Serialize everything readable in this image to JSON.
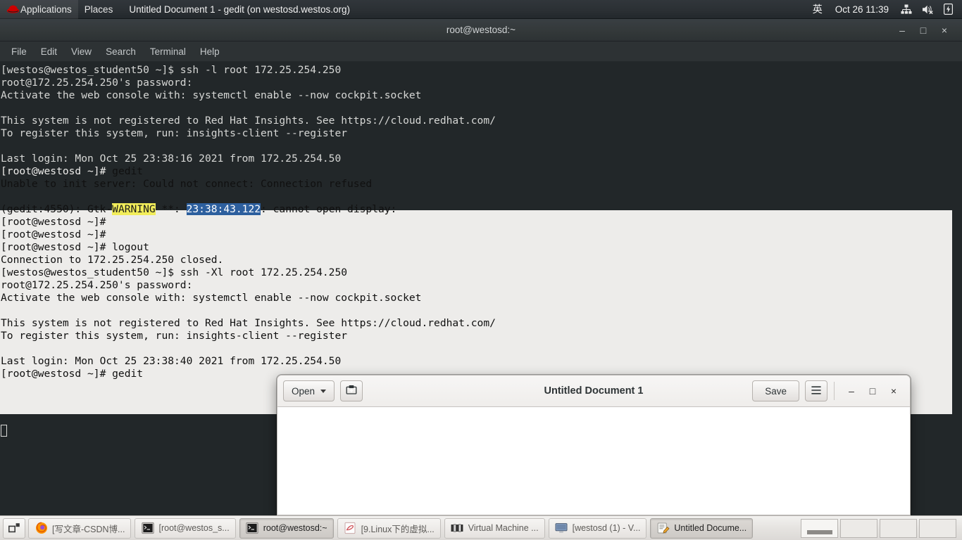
{
  "top_panel": {
    "logo_icon": "redhat-logo-icon",
    "applications_label": "Applications",
    "places_label": "Places",
    "window_title": "Untitled Document 1 - gedit (on westosd.westos.org)",
    "ime_label": "英",
    "clock": "Oct 26  11:39",
    "network_icon": "network-wired-icon",
    "volume_icon": "volume-muted-icon",
    "battery_icon": "battery-charging-icon"
  },
  "terminal": {
    "title": "root@westosd:~",
    "menu": [
      "File",
      "Edit",
      "View",
      "Search",
      "Terminal",
      "Help"
    ],
    "window_buttons": {
      "minimize": "–",
      "maximize": "□",
      "close": "×"
    },
    "lines": [
      {
        "text": "[westos@westos_student50 ~]$ ssh -l root 172.25.254.250",
        "light": false
      },
      {
        "text": "root@172.25.254.250's password:",
        "light": false
      },
      {
        "text": "Activate the web console with: systemctl enable --now cockpit.socket",
        "light": false
      },
      {
        "text": "",
        "light": false
      },
      {
        "text": "This system is not registered to Red Hat Insights. See https://cloud.redhat.com/",
        "light": false
      },
      {
        "text": "To register this system, run: insights-client --register",
        "light": false
      },
      {
        "text": "",
        "light": false
      },
      {
        "text": "Last login: Mon Oct 25 23:38:16 2021 from 172.25.254.50",
        "light": false
      },
      {
        "text": "[root@westosd ~]# gedit",
        "light": true,
        "invert_prefix": "[root@westosd ~]# "
      },
      {
        "text": "Unable to init server: Could not connect: Connection refused",
        "light": true
      },
      {
        "text": "",
        "light": true
      },
      {
        "text": "(gedit:4550): Gtk-WARNING **: 23:38:43.122: cannot open display:",
        "light": true,
        "segments": [
          {
            "t": "(gedit:4550): Gtk-",
            "s": ""
          },
          {
            "t": "WARNING",
            "s": "yellow"
          },
          {
            "t": " **: ",
            "s": ""
          },
          {
            "t": "23:38:43.122",
            "s": "blue"
          },
          {
            "t": ": cannot open display:",
            "s": ""
          }
        ]
      },
      {
        "text": "[root@westosd ~]#",
        "light": true
      },
      {
        "text": "[root@westosd ~]#",
        "light": true
      },
      {
        "text": "[root@westosd ~]# logout",
        "light": true
      },
      {
        "text": "Connection to 172.25.254.250 closed.",
        "light": true
      },
      {
        "text": "[westos@westos_student50 ~]$ ssh -Xl root 172.25.254.250",
        "light": true
      },
      {
        "text": "root@172.25.254.250's password:",
        "light": true
      },
      {
        "text": "Activate the web console with: systemctl enable --now cockpit.socket",
        "light": true
      },
      {
        "text": "",
        "light": true
      },
      {
        "text": "This system is not registered to Red Hat Insights. See https://cloud.redhat.com/",
        "light": true
      },
      {
        "text": "To register this system, run: insights-client --register",
        "light": true
      },
      {
        "text": "",
        "light": true
      },
      {
        "text": "Last login: Mon Oct 25 23:38:40 2021 from 172.25.254.50",
        "light": true
      },
      {
        "text": "[root@westosd ~]# gedit",
        "light": true,
        "invert_tail": true
      }
    ]
  },
  "gedit": {
    "open_label": "Open",
    "new_document_icon": "new-document-icon",
    "title": "Untitled Document 1",
    "save_label": "Save",
    "hamburger_icon": "hamburger-menu-icon",
    "minimize_label": "–",
    "maximize_label": "□",
    "close_label": "×",
    "document_text": ""
  },
  "taskbar": {
    "show_desktop_icon": "show-desktop-icon",
    "tasks": [
      {
        "label": "[写文章-CSDN博...",
        "icon": "firefox-icon",
        "active": false
      },
      {
        "label": "[root@westos_s...",
        "icon": "terminal-icon",
        "active": false
      },
      {
        "label": "root@westosd:~",
        "icon": "terminal-icon",
        "active": true
      },
      {
        "label": "[9.Linux下的虚拟...",
        "icon": "evernote-icon",
        "active": false
      },
      {
        "label": "Virtual Machine ...",
        "icon": "virtual-machine-manager-icon",
        "active": false
      },
      {
        "label": "[westosd (1) - V...",
        "icon": "display-icon",
        "active": false
      },
      {
        "label": "Untitled Docume...",
        "icon": "gedit-icon",
        "active": true
      }
    ],
    "workspaces": [
      {
        "active": true,
        "has_window": true
      },
      {
        "active": false,
        "has_window": false
      },
      {
        "active": false,
        "has_window": false
      },
      {
        "active": false,
        "has_window": false
      }
    ]
  },
  "colors": {
    "terminal_bg": "#222729",
    "terminal_fg": "#d6d7d5",
    "light_region": "#edecea",
    "warning_highlight": "#f2ed5a",
    "time_highlight": "#2d5f9e",
    "accent_red": "#cc0000"
  }
}
